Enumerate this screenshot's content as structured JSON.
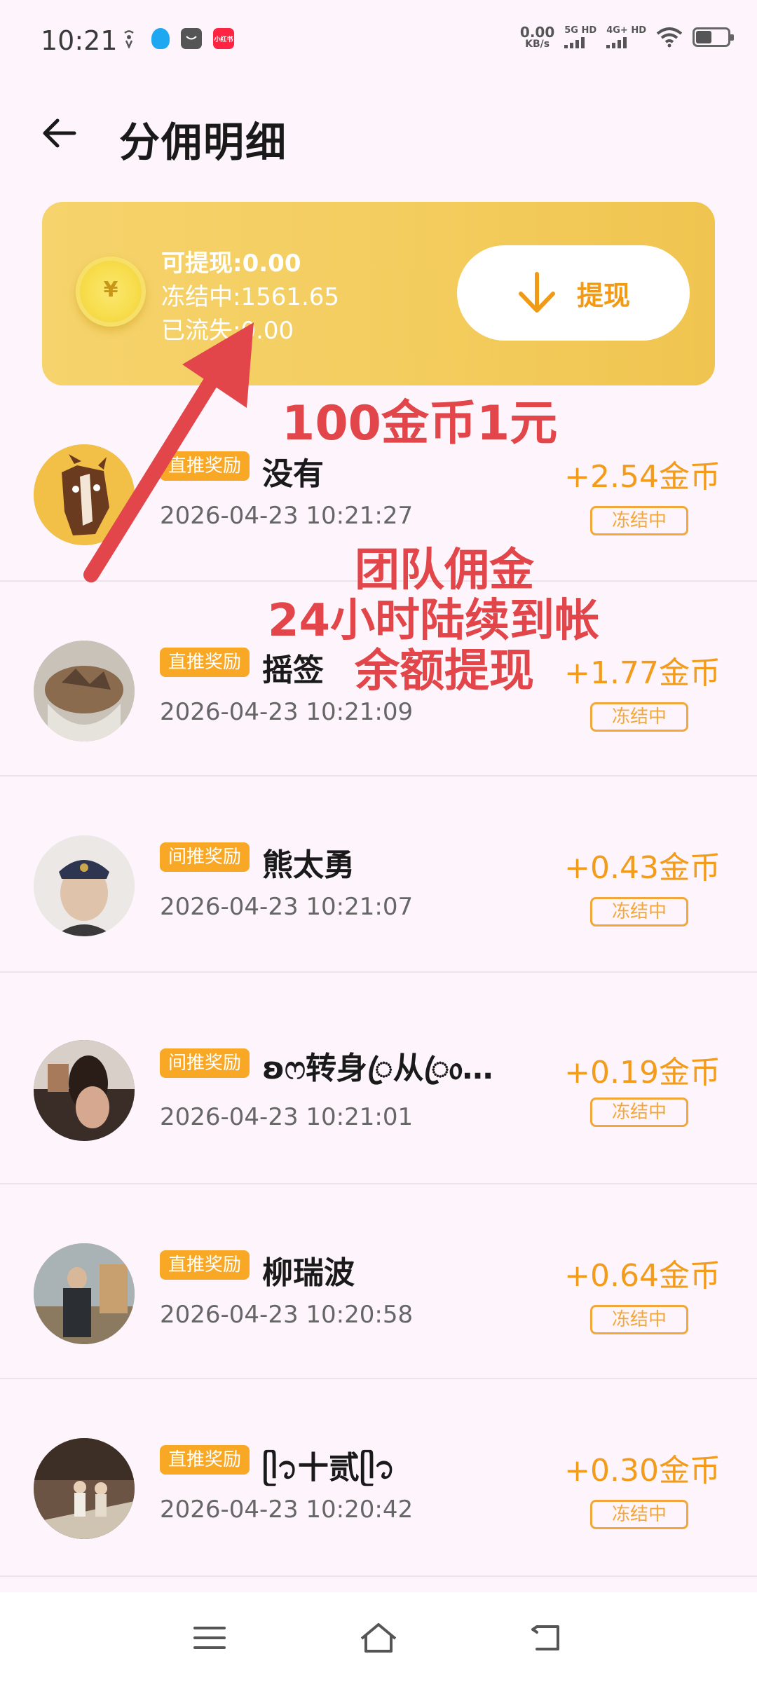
{
  "status_bar": {
    "time": "10:21",
    "net_speed_value": "0.00",
    "net_speed_unit": "KB/s",
    "sim1_label": "5G HD",
    "sim2_label": "4G+ HD",
    "app_icon_label": "小红书"
  },
  "header": {
    "title": "分佣明细"
  },
  "balance": {
    "withdrawable": "可提现:0.00",
    "frozen": "冻结中:1561.65",
    "lost": "已流失:0.00",
    "withdraw_label": "提现",
    "coin_symbol": "¥"
  },
  "records": [
    {
      "tag": "直推奖励",
      "name": "没有",
      "time": "2026-04-23 10:21:27",
      "amount": "+2.54金币",
      "status": "冻结中"
    },
    {
      "tag": "直推奖励",
      "name": "摇签",
      "time": "2026-04-23 10:21:09",
      "amount": "+1.77金币",
      "status": "冻结中"
    },
    {
      "tag": "间推奖励",
      "name": "熊太勇",
      "time": "2026-04-23 10:21:07",
      "amount": "+0.43金币",
      "status": "冻结中"
    },
    {
      "tag": "间推奖励",
      "name": "ʚෆ转身ꦿ从ꦿ᥆…",
      "time": "2026-04-23 10:21:01",
      "amount": "+0.19金币",
      "status": "冻结中"
    },
    {
      "tag": "直推奖励",
      "name": "柳瑞波",
      "time": "2026-04-23 10:20:58",
      "amount": "+0.64金币",
      "status": "冻结中"
    },
    {
      "tag": "直推奖励",
      "name": "ᥫ᭡十贰ᥫ᭡",
      "time": "2026-04-23 10:20:42",
      "amount": "+0.30金币",
      "status": "冻结中"
    }
  ],
  "annotation": {
    "line1": "100金币1元",
    "line2": "团队佣金",
    "line3": "24小时陆续到帐",
    "line4": "余额提现",
    "color": "#e2464b"
  },
  "colors": {
    "accent": "#f39b1a",
    "card": "#f3cc5d",
    "tag": "#f9a825",
    "background": "#fdf5fb"
  }
}
